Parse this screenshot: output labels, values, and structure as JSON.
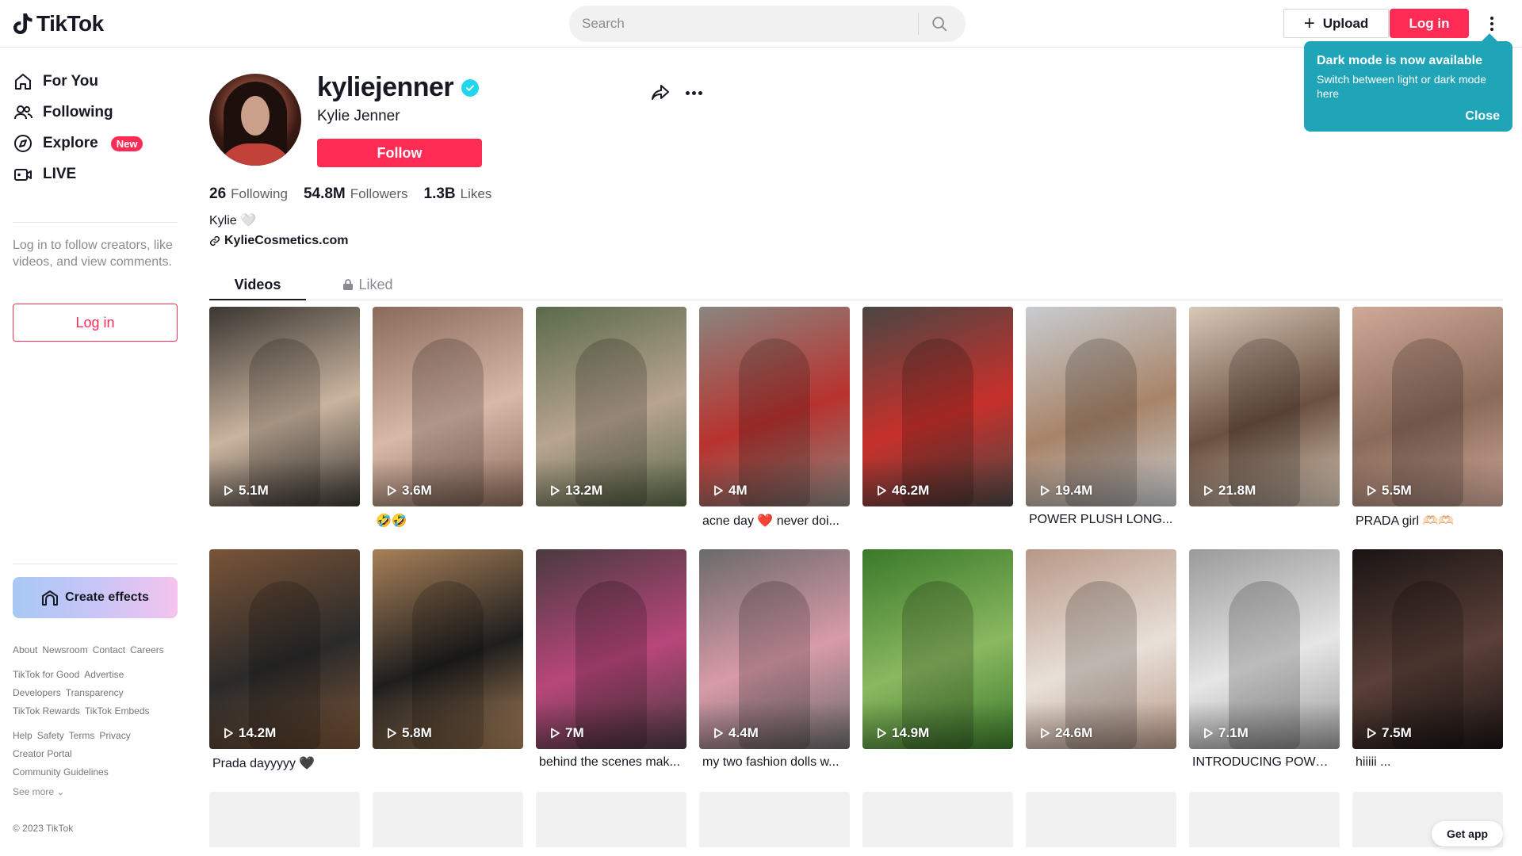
{
  "header": {
    "logo_text": "TikTok",
    "search_placeholder": "Search",
    "upload_label": "Upload",
    "login_label": "Log in"
  },
  "tooltip": {
    "title": "Dark mode is now available",
    "body": "Switch between light or dark mode here",
    "close_label": "Close"
  },
  "sidebar": {
    "items": [
      {
        "label": "For You",
        "icon": "home-icon"
      },
      {
        "label": "Following",
        "icon": "users-icon"
      },
      {
        "label": "Explore",
        "icon": "compass-icon",
        "badge": "New"
      },
      {
        "label": "LIVE",
        "icon": "live-icon"
      }
    ],
    "login_hint": "Log in to follow creators, like videos, and view comments.",
    "login_label": "Log in",
    "create_effects_label": "Create effects",
    "footer_rows": [
      [
        "About",
        "Newsroom",
        "Contact",
        "Careers"
      ],
      [
        "TikTok for Good",
        "Advertise"
      ],
      [
        "Developers",
        "Transparency"
      ],
      [
        "TikTok Rewards",
        "TikTok Embeds"
      ],
      [
        "Help",
        "Safety",
        "Terms",
        "Privacy"
      ],
      [
        "Creator Portal"
      ],
      [
        "Community Guidelines"
      ]
    ],
    "see_more": "See more",
    "copyright": "© 2023 TikTok"
  },
  "profile": {
    "username": "kyliejenner",
    "nickname": "Kylie Jenner",
    "follow_label": "Follow",
    "stats": [
      {
        "num": "26",
        "label": "Following"
      },
      {
        "num": "54.8M",
        "label": "Followers"
      },
      {
        "num": "1.3B",
        "label": "Likes"
      }
    ],
    "bio": "Kylie 🤍",
    "link": "KylieCosmetics.com"
  },
  "tabs": {
    "videos": "Videos",
    "liked": "Liked"
  },
  "videos": [
    {
      "plays": "5.1M",
      "caption": ""
    },
    {
      "plays": "3.6M",
      "caption": "🤣🤣"
    },
    {
      "plays": "13.2M",
      "caption": ""
    },
    {
      "plays": "4M",
      "caption": "acne day ❤️ never doi..."
    },
    {
      "plays": "46.2M",
      "caption": ""
    },
    {
      "plays": "19.4M",
      "caption": "POWER PLUSH LONG..."
    },
    {
      "plays": "21.8M",
      "caption": ""
    },
    {
      "plays": "5.5M",
      "caption": "PRADA girl 🫶🏻🫶🏻"
    },
    {
      "plays": "14.2M",
      "caption": "Prada dayyyyy 🖤"
    },
    {
      "plays": "5.8M",
      "caption": ""
    },
    {
      "plays": "7M",
      "caption": "behind the scenes mak..."
    },
    {
      "plays": "4.4M",
      "caption": "my two fashion dolls w..."
    },
    {
      "plays": "14.9M",
      "caption": ""
    },
    {
      "plays": "24.6M",
      "caption": ""
    },
    {
      "plays": "7.1M",
      "caption": "INTRODUCING POWER ..."
    },
    {
      "plays": "7.5M",
      "caption": "hiiiii ..."
    }
  ],
  "thumb_colors": [
    [
      "#3a3632",
      "#c9b49f"
    ],
    [
      "#8a6a5a",
      "#d8b8a8"
    ],
    [
      "#5a6a4a",
      "#b8a490"
    ],
    [
      "#8a8680",
      "#b8322e"
    ],
    [
      "#4a4644",
      "#c8302a"
    ],
    [
      "#c8ccd0",
      "#a88468"
    ],
    [
      "#d8c8b8",
      "#6a5040"
    ],
    [
      "#d0a898",
      "#8a6a5a"
    ],
    [
      "#7a5438",
      "#2a2a2a"
    ],
    [
      "#a88058",
      "#1e1e1e"
    ],
    [
      "#4a3a40",
      "#b8467a"
    ],
    [
      "#6a6a6a",
      "#d89aa8"
    ],
    [
      "#3a7a2a",
      "#8ab860"
    ],
    [
      "#b89888",
      "#e8e0d8"
    ],
    [
      "#9a9a9a",
      "#e6e6e6"
    ],
    [
      "#1a1414",
      "#5a4038"
    ]
  ],
  "get_app": "Get app"
}
